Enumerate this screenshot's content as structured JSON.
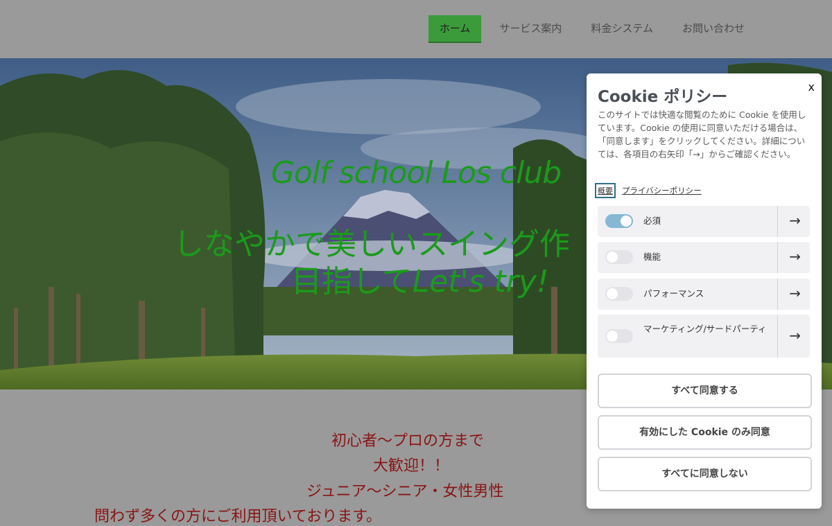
{
  "nav": {
    "items": [
      {
        "label": "ホーム",
        "active": true
      },
      {
        "label": "サービス案内",
        "active": false
      },
      {
        "label": "料金システム",
        "active": false
      },
      {
        "label": "お問い合わせ",
        "active": false
      }
    ]
  },
  "hero": {
    "title": "Golf school Los club",
    "tagline_1": "しなやかで美しいスイング作",
    "tagline_2_jp": "目指して",
    "tagline_2_en": "Let's try!",
    "text_color": "#1a9b1a"
  },
  "intro": {
    "lines": [
      "初心者〜プロの方まで",
      "大歓迎！！",
      "ジュニア〜シニア・女性男性",
      "問わず多くの方にご利用頂いております。"
    ],
    "text_color": "#8a1414"
  },
  "cookie": {
    "title": "Cookie ポリシー",
    "close_label": "x",
    "description": "このサイトでは快適な閲覧のために Cookie を使用しています。Cookie の使用に同意いただける場合は、「同意します」をクリックしてください。詳細については、各項目の右矢印「→」からご確認ください。",
    "tab_summary": "概要",
    "tab_privacy": "プライバシーポリシー",
    "categories": [
      {
        "label": "必須",
        "enabled": true
      },
      {
        "label": "機能",
        "enabled": false
      },
      {
        "label": "パフォーマンス",
        "enabled": false
      },
      {
        "label": "マーケティング/サードパーティ",
        "enabled": false
      }
    ],
    "arrow_icon": "→",
    "buttons": {
      "accept_all": "すべて同意する",
      "accept_selected": "有効にした Cookie のみ同意",
      "reject_all": "すべてに同意しない"
    },
    "toggle_on_color": "#86b8d4"
  }
}
